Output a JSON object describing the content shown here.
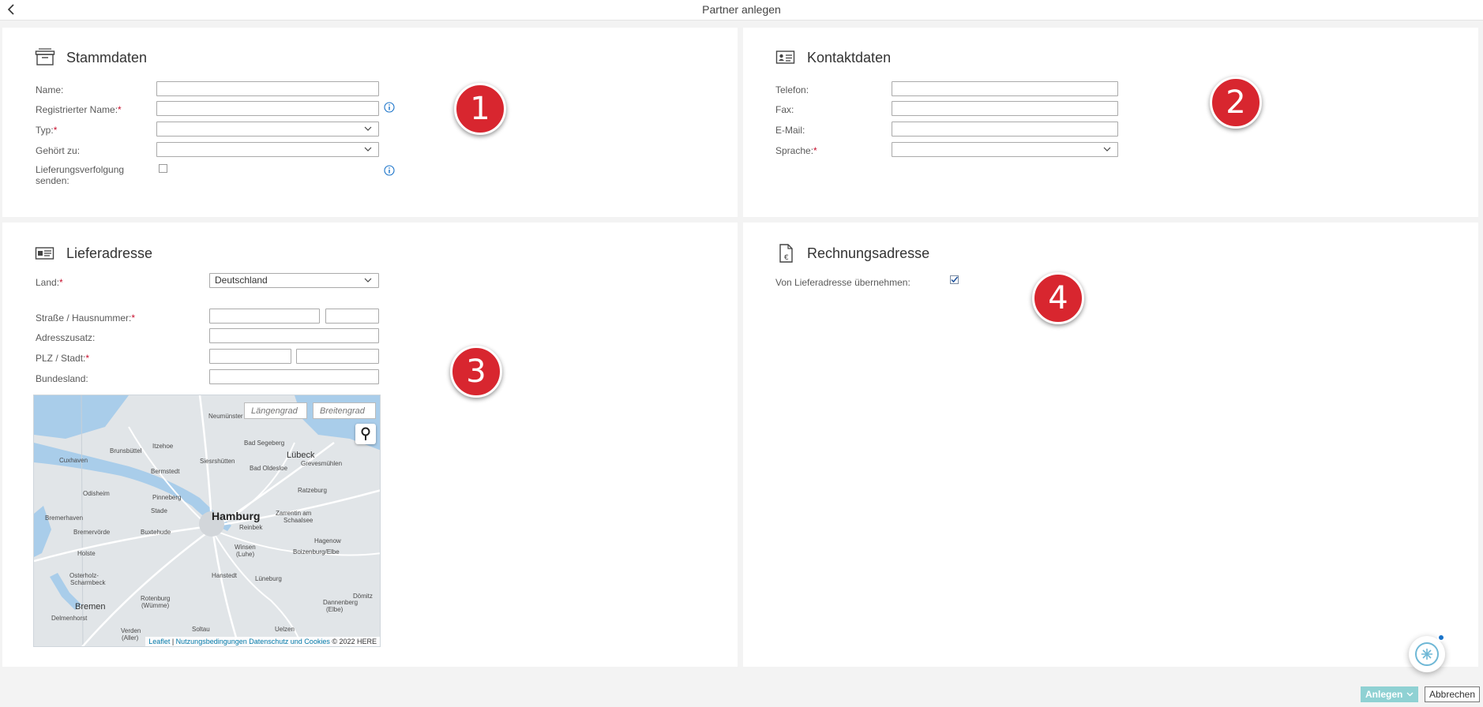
{
  "header": {
    "title": "Partner anlegen"
  },
  "stammdaten": {
    "title": "Stammdaten",
    "name_label": "Name:",
    "registered_name_label": "Registrierter Name:",
    "type_label": "Typ:",
    "belongs_to_label": "Gehört zu:",
    "tracking_label_line1": "Lieferungsverfolgung",
    "tracking_label_line2": "senden:"
  },
  "kontaktdaten": {
    "title": "Kontaktdaten",
    "phone_label": "Telefon:",
    "fax_label": "Fax:",
    "email_label": "E-Mail:",
    "language_label": "Sprache:"
  },
  "lieferadresse": {
    "title": "Lieferadresse",
    "country_label": "Land:",
    "country_value": "Deutschland",
    "street_label": "Straße / Hausnummer:",
    "address_extra_label": "Adresszusatz:",
    "zip_city_label": "PLZ / Stadt:",
    "state_label": "Bundesland:"
  },
  "map": {
    "longitude_placeholder": "Längengrad",
    "latitude_placeholder": "Breitengrad",
    "attribution_leaflet": "Leaflet",
    "attribution_sep": " | ",
    "attribution_terms": "Nutzungsbedingungen",
    "attribution_privacy": "Datenschutz und Cookies",
    "attribution_copy": " © 2022 HERE",
    "cities": {
      "hamburg": "Hamburg",
      "bremen": "Bremen",
      "luebeck": "Lübeck",
      "cuxhaven": "Cuxhaven",
      "itzehoe": "Itzehoe",
      "neumuenster": "Neumünster",
      "bad_segeberg": "Bad Segeberg",
      "bad_oldesloe": "Bad Oldesloe",
      "stade": "Stade",
      "buxtehude": "Buxtehude",
      "pinneberg": "Pinneberg",
      "bremerhaven": "Bremerhaven",
      "bremervoerde": "Bremervörde",
      "lueneburg": "Lüneburg",
      "winsen": "Winsen",
      "winsen2": "(Luhe)",
      "reinbek": "Reinbek",
      "ratzeburg": "Ratzeburg",
      "zarrentin": "Zarrentin am",
      "zarrentin2": "Schaalsee",
      "hagenow": "Hagenow",
      "boizenburg": "Boizenburg/Elbe",
      "uelzen": "Uelzen",
      "soltau": "Soltau",
      "rotenburg": "Rotenburg",
      "rotenburg2": "(Wümme)",
      "osterholz": "Osterholz-",
      "osterholz2": "Scharmbeck",
      "delmenhorst": "Delmenhorst",
      "verden": "Verden",
      "verden2": "(Aller)",
      "dannenberg": "Dannenberg",
      "dannenberg2": "(Elbe)",
      "hanstedt": "Hanstedt",
      "siesbuettel": "Siesrshütten",
      "bermstedt": "Bermstedt",
      "brunsbuettel": "Brunsbüttel",
      "odisheim": "Odisheim",
      "holste": "Holste",
      "gerevesmuehlen": "Grevesmühlen",
      "doemitz": "Dömitz"
    }
  },
  "rechnungsadresse": {
    "title": "Rechnungsadresse",
    "copy_label": "Von Lieferadresse übernehmen:",
    "copy_checked": true
  },
  "badges": {
    "b1": "1",
    "b2": "2",
    "b3": "3",
    "b4": "4"
  },
  "footer": {
    "create_label": "Anlegen",
    "cancel_label": "Abbrechen"
  },
  "colors": {
    "accent": "#8fd1d3",
    "required": "#c8102e",
    "badge": "#d8262f",
    "info": "#1a73c9"
  }
}
